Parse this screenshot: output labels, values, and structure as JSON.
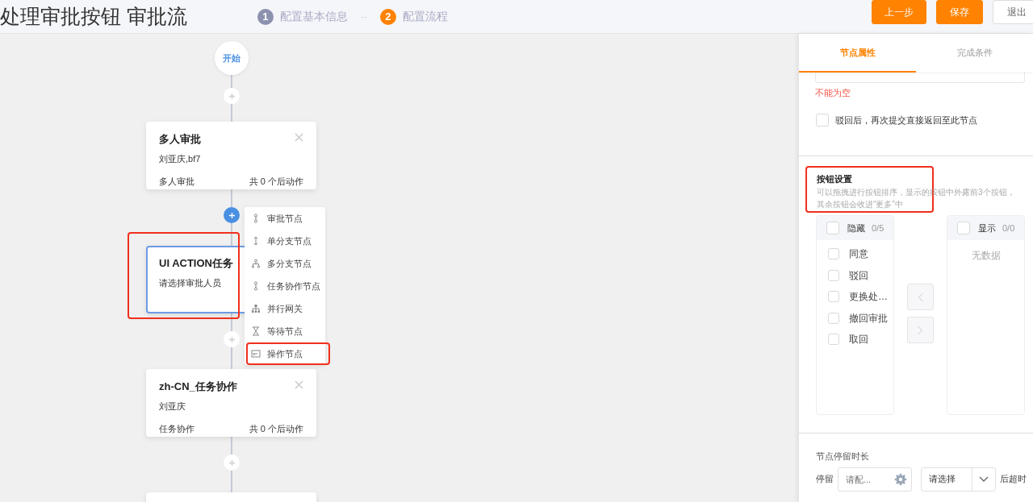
{
  "header": {
    "title": "处理审批按钮 审批流",
    "separator": "··",
    "steps": [
      {
        "number": "1",
        "label": "配置基本信息",
        "selected": false
      },
      {
        "number": "2",
        "label": "配置流程",
        "selected": true
      }
    ],
    "buttons": [
      {
        "label": "上一步",
        "kind": "primary"
      },
      {
        "label": "保存",
        "kind": "primary"
      },
      {
        "label": "退出",
        "kind": "default"
      }
    ]
  },
  "canvas": {
    "start": "开始",
    "add_buttons": [
      {
        "active": false
      },
      {
        "active": true
      },
      {
        "active": false
      },
      {
        "active": false
      }
    ],
    "nodes": [
      {
        "title": "多人审批",
        "assignee": "刘亚庆,bf7",
        "type": "多人审批",
        "actions": "共 0 个后动作",
        "selected": false,
        "highlighted": false
      },
      {
        "title": "UI ACTION任务",
        "assignee": "请选择审批人员",
        "selected": true,
        "highlighted": true
      },
      {
        "title": "zh-CN_任务协作",
        "assignee": "刘亚庆",
        "type": "任务协作",
        "actions": "共 0 个后动作",
        "selected": false,
        "highlighted": false
      },
      {
        "selected": false,
        "highlighted": false
      }
    ],
    "menu": [
      {
        "label": "审批节点",
        "kind": "approve",
        "highlighted": false
      },
      {
        "label": "单分支节点",
        "kind": "single-branch",
        "highlighted": false
      },
      {
        "label": "多分支节点",
        "kind": "multi-branch",
        "highlighted": false
      },
      {
        "label": "任务协作节点",
        "kind": "task",
        "highlighted": false
      },
      {
        "label": "并行网关",
        "kind": "parallel",
        "highlighted": false
      },
      {
        "label": "等待节点",
        "kind": "wait",
        "highlighted": false
      },
      {
        "label": "操作节点",
        "kind": "operation",
        "highlighted": true
      }
    ]
  },
  "panel": {
    "tabs": [
      {
        "label": "节点属性",
        "selected": true
      },
      {
        "label": "完成条件",
        "selected": false
      }
    ],
    "error": "不能为空",
    "return_option": {
      "label": "驳回后，再次提交直接返回至此节点",
      "checked": false
    },
    "button_settings": {
      "title": "按钮设置",
      "description": "可以拖拽进行按钮排序，显示的按钮中外露前3个按钮，其余按钮会收进“更多”中",
      "highlighted": true
    },
    "transfer": {
      "left": {
        "title": "隐藏",
        "count": "0/5",
        "checked": false,
        "items": [
          {
            "label": "同意",
            "checked": false
          },
          {
            "label": "驳回",
            "checked": false
          },
          {
            "label": "更换处…",
            "checked": false
          },
          {
            "label": "撤回审批",
            "checked": false
          },
          {
            "label": "取回",
            "checked": false
          }
        ]
      },
      "right": {
        "title": "显示",
        "count": "0/0",
        "checked": false,
        "empty": "无数据"
      }
    },
    "duration": {
      "label": "节点停留时长",
      "prefix": "停留",
      "placeholder": "请配...",
      "select": "请选择",
      "suffix": "后超时"
    }
  }
}
